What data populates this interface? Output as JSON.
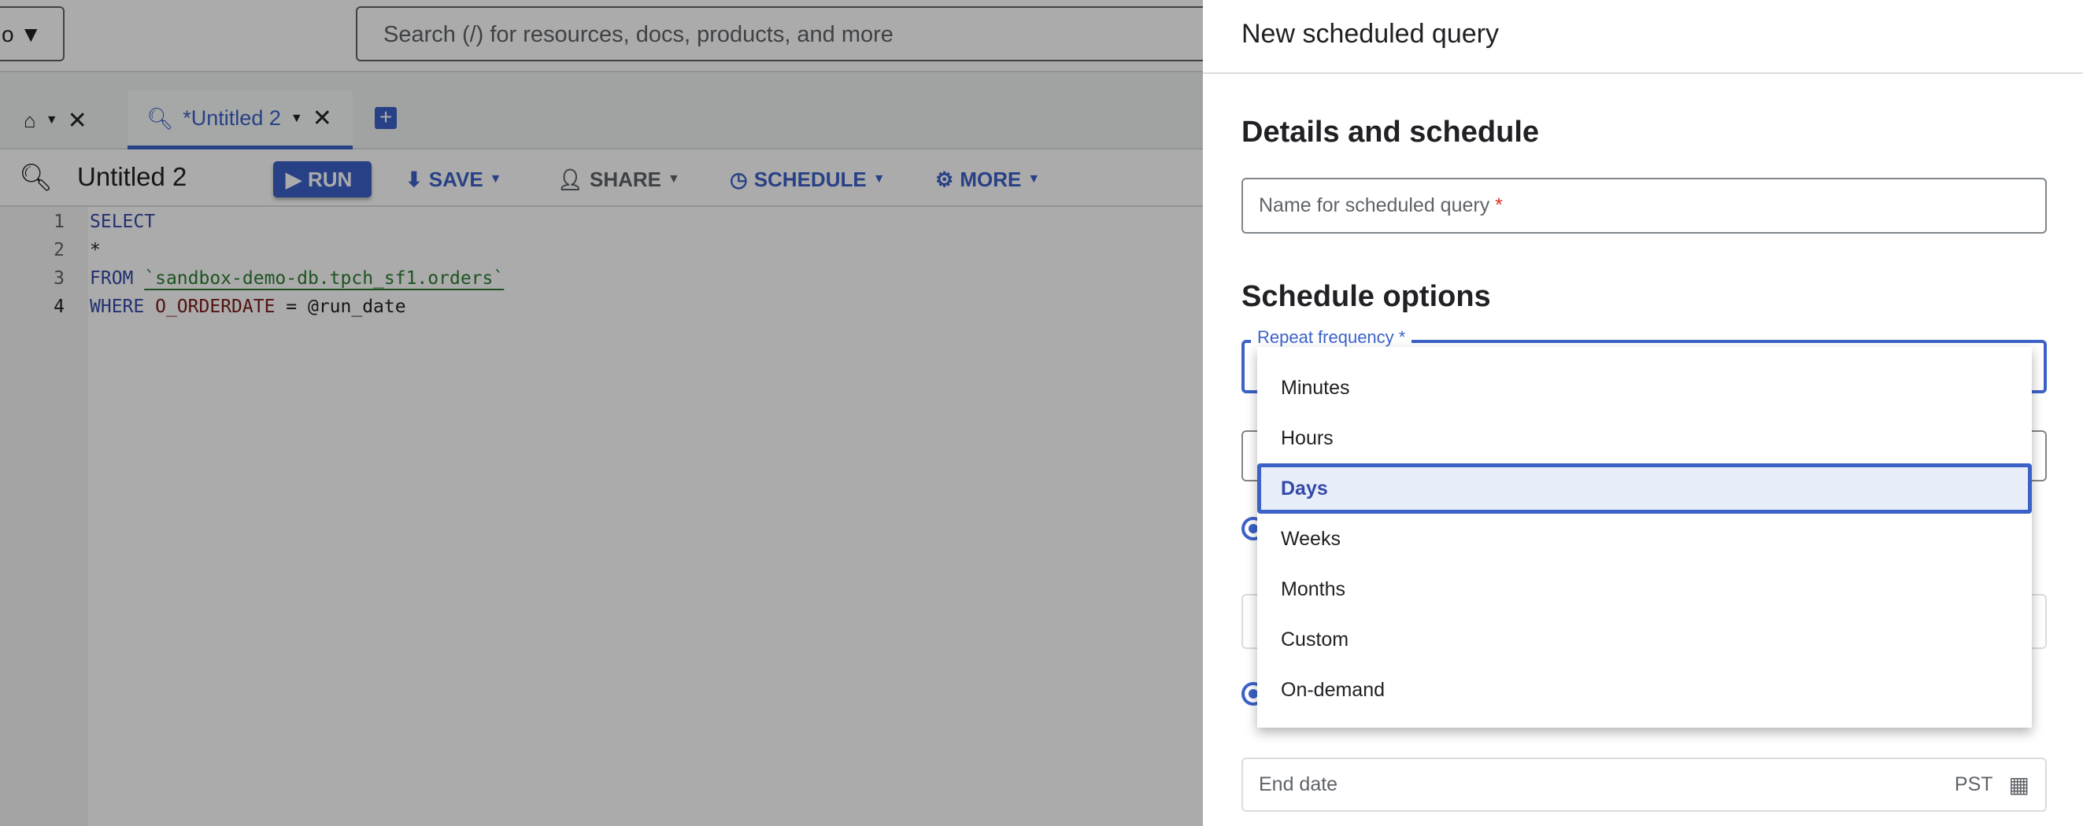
{
  "topbar": {
    "project_partial": "o",
    "search_placeholder": "Search (/) for resources, docs, products, and more"
  },
  "tabs": [
    {
      "label": "",
      "icon": "home-icon"
    },
    {
      "label": "*Untitled 2",
      "icon": "query-icon",
      "active": true
    }
  ],
  "toolbar": {
    "title": "Untitled 2",
    "run": "RUN",
    "save": "SAVE",
    "share": "SHARE",
    "schedule": "SCHEDULE",
    "more": "MORE"
  },
  "editor": {
    "lines": [
      {
        "n": "1",
        "kw": "SELECT",
        "rest": ""
      },
      {
        "n": "2",
        "text": "*"
      },
      {
        "n": "3",
        "kw": "FROM",
        "str": "`sandbox-demo-db.tpch_sf1.orders`"
      },
      {
        "n": "4",
        "kw": "WHERE",
        "col": "O_ORDERDATE",
        "rest": " = @run_date"
      }
    ]
  },
  "panel": {
    "title": "New scheduled query",
    "section1": "Details and schedule",
    "name_placeholder": "Name for scheduled query",
    "required_mark": "*",
    "section2": "Schedule options",
    "repeat_label": "Repeat frequency *",
    "options": [
      "Minutes",
      "Hours",
      "Days",
      "Weeks",
      "Months",
      "Custom",
      "On-demand"
    ],
    "selected": "Days",
    "end_date_placeholder": "End date",
    "timezone": "PST"
  },
  "colors": {
    "accent": "#3c62c8",
    "selected_bg": "#e8eef9"
  }
}
